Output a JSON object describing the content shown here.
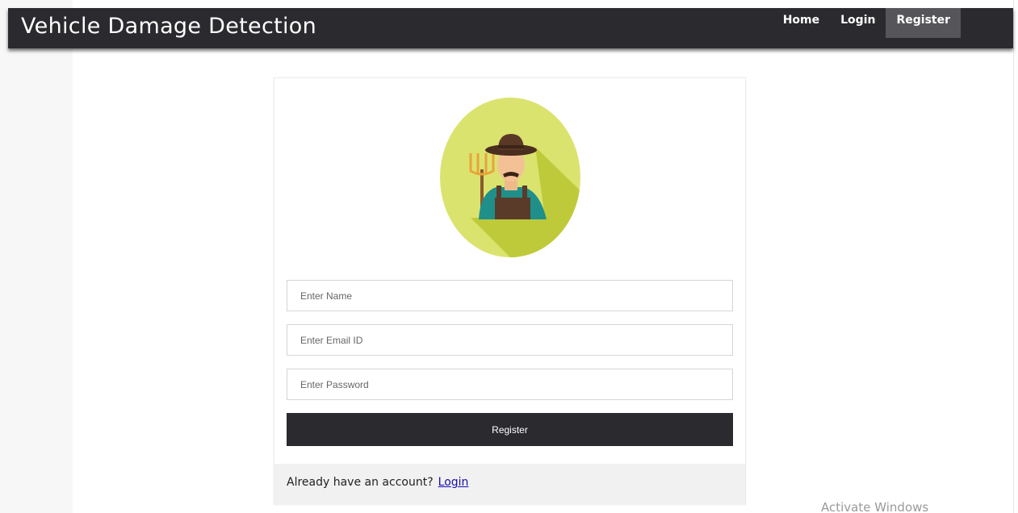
{
  "navbar": {
    "brand": "Vehicle Damage Detection",
    "links": [
      {
        "label": "Home"
      },
      {
        "label": "Login"
      },
      {
        "label": "Register"
      }
    ]
  },
  "form": {
    "avatar_icon": "farmer-avatar-icon",
    "name_placeholder": "Enter Name",
    "email_placeholder": "Enter Email ID",
    "password_placeholder": "Enter Password",
    "submit_label": "Register",
    "footer_text": "Already have an account?",
    "footer_link": "Login"
  },
  "watermark": "Activate Windows",
  "colors": {
    "navbar_bg": "#2b2a2e",
    "nav_active_bg": "#55555a",
    "avatar_circle": "#dbe36f",
    "avatar_shadow": "#bfca3a",
    "link": "#1a0dab"
  }
}
